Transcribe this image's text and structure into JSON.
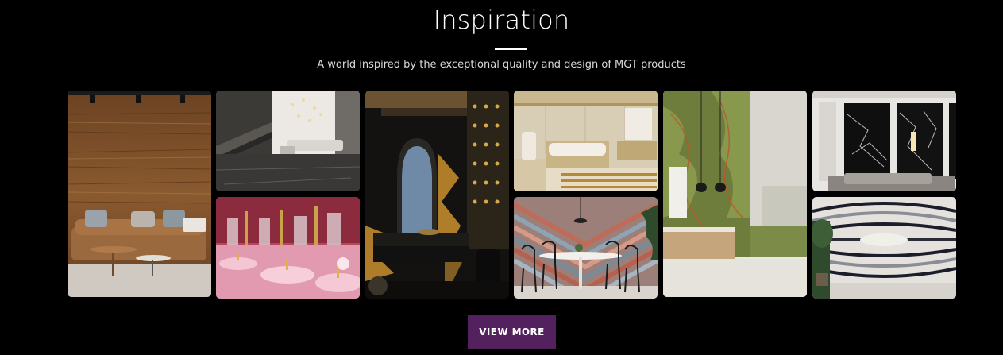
{
  "section": {
    "title": "Inspiration",
    "subtitle": "A world inspired by the exceptional quality and design of MGT products"
  },
  "gallery": {
    "tiles": [
      {
        "scene": "living room with brown travertine feature wall and leather sofa"
      },
      {
        "scene": "modern lounge with grey marble floor and floating staircase"
      },
      {
        "scene": "pink onyx washbasins with gold fixtures"
      },
      {
        "scene": "dark bathroom with black and gold marble walls"
      },
      {
        "scene": "beige marble bathroom with bathtub"
      },
      {
        "scene": "dining area with red and grey striped marble wall"
      },
      {
        "scene": "bathroom with green onyx wall and vanity"
      },
      {
        "scene": "classic room with black marble wall panels"
      },
      {
        "scene": "interior with black and white patterned marble wall"
      }
    ]
  },
  "actions": {
    "view_more_label": "VIEW MORE"
  },
  "colors": {
    "background": "#000000",
    "button": "#53215e",
    "text": "#ffffff"
  }
}
